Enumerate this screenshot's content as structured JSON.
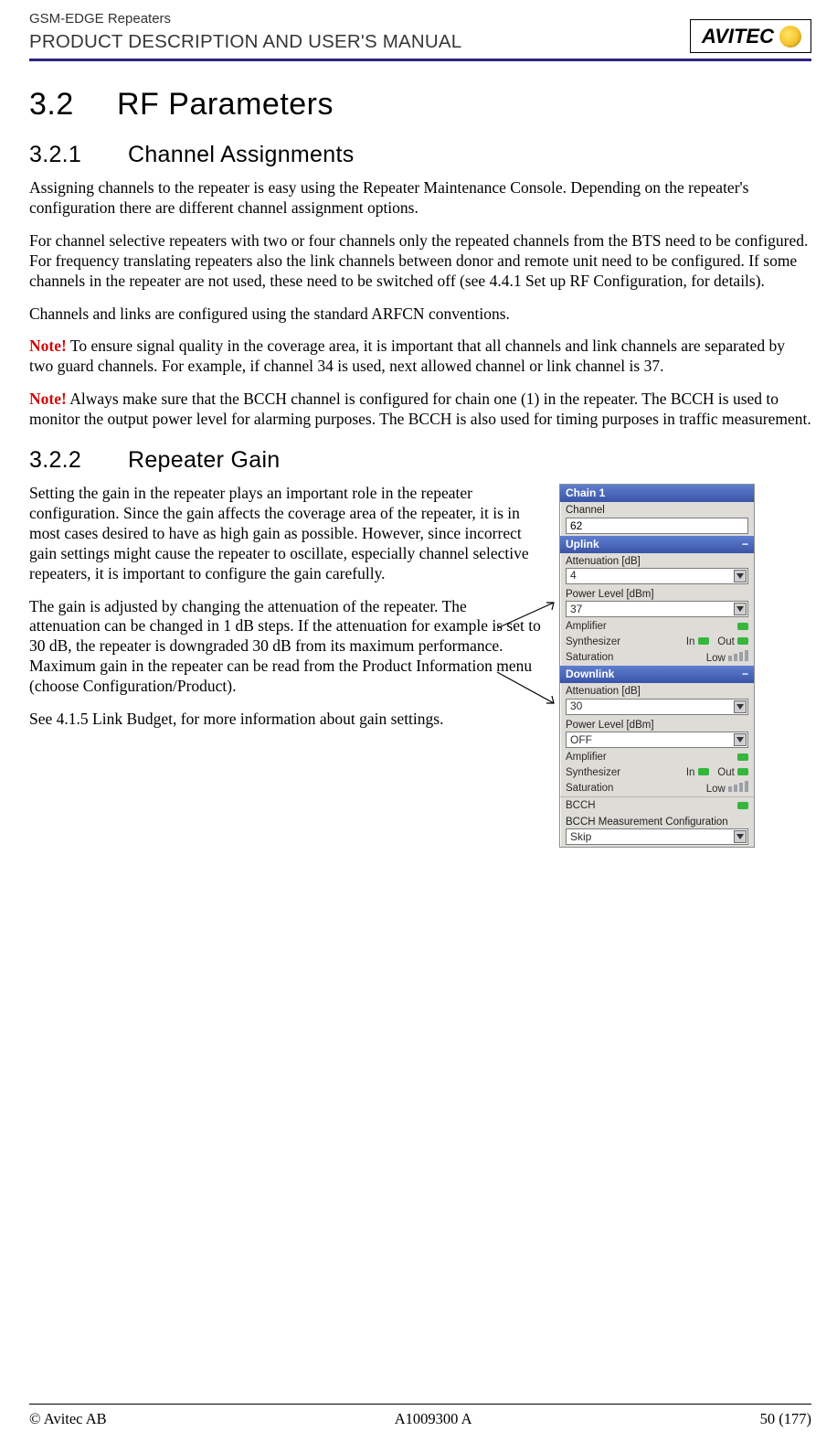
{
  "header": {
    "product_line": "GSM-EDGE Repeaters",
    "doc_title": "PRODUCT DESCRIPTION AND USER'S MANUAL",
    "logo_text": "AVITEC"
  },
  "section": {
    "number": "3.2",
    "title": "RF Parameters"
  },
  "sub1": {
    "number": "3.2.1",
    "title": "Channel Assignments",
    "p1": "Assigning channels to the repeater is easy using the Repeater Maintenance Console. Depending on the repeater's configuration there are different channel assignment options.",
    "p2": "For channel selective repeaters with two or four channels only the repeated channels from the BTS need to be configured. For frequency translating repeaters also the link channels between donor and remote unit need to be configured. If some channels in the repeater are not used, these need to be switched off (see 4.4.1 Set up RF Configuration, for details).",
    "p3": "Channels and links are configured using the standard ARFCN conventions.",
    "note1_label": "Note!",
    "note1_text": " To ensure signal quality in the coverage area, it is important that all channels and link channels are separated by two guard channels. For example, if channel 34 is used, next allowed channel or link channel is 37.",
    "note2_label": "Note!",
    "note2_text": " Always make sure that the BCCH channel is configured for chain one (1) in the repeater. The BCCH is used to monitor the output power level for alarming purposes. The BCCH is also used for timing purposes in traffic measurement."
  },
  "sub2": {
    "number": "3.2.2",
    "title": "Repeater Gain",
    "p1": "Setting the gain in the repeater plays an important role in the repeater configuration. Since the gain affects the coverage area of the repeater, it is in most cases desired to have as high gain as possible. However, since incorrect gain settings might cause the repeater to oscillate, especially channel selective repeaters, it is important to configure the gain carefully.",
    "p2": "The gain is adjusted by changing the attenuation of the repeater. The attenuation can be changed in 1 dB steps. If the attenuation for example is set to 30 dB, the repeater is downgraded 30 dB from its maximum performance. Maximum gain in the repeater can be read from the Product Information menu (choose Configuration/Product).",
    "p3": "See 4.1.5 Link Budget, for more information about gain settings."
  },
  "ui": {
    "chain_title": "Chain 1",
    "channel_label": "Channel",
    "channel_value": "62",
    "uplink_title": "Uplink",
    "atten_label": "Attenuation [dB]",
    "uplink_atten": "4",
    "power_label": "Power Level [dBm]",
    "uplink_power": "37",
    "amp_label": "Amplifier",
    "synth_label": "Synthesizer",
    "in_label": "In",
    "out_label": "Out",
    "sat_label": "Saturation",
    "sat_low": "Low",
    "downlink_title": "Downlink",
    "downlink_atten": "30",
    "downlink_power": "OFF",
    "bcch_label": "BCCH",
    "bcch_conf_label": "BCCH Measurement Configuration",
    "bcch_value": "Skip"
  },
  "footer": {
    "left": "© Avitec AB",
    "center": "A1009300 A",
    "right": "50 (177)"
  }
}
